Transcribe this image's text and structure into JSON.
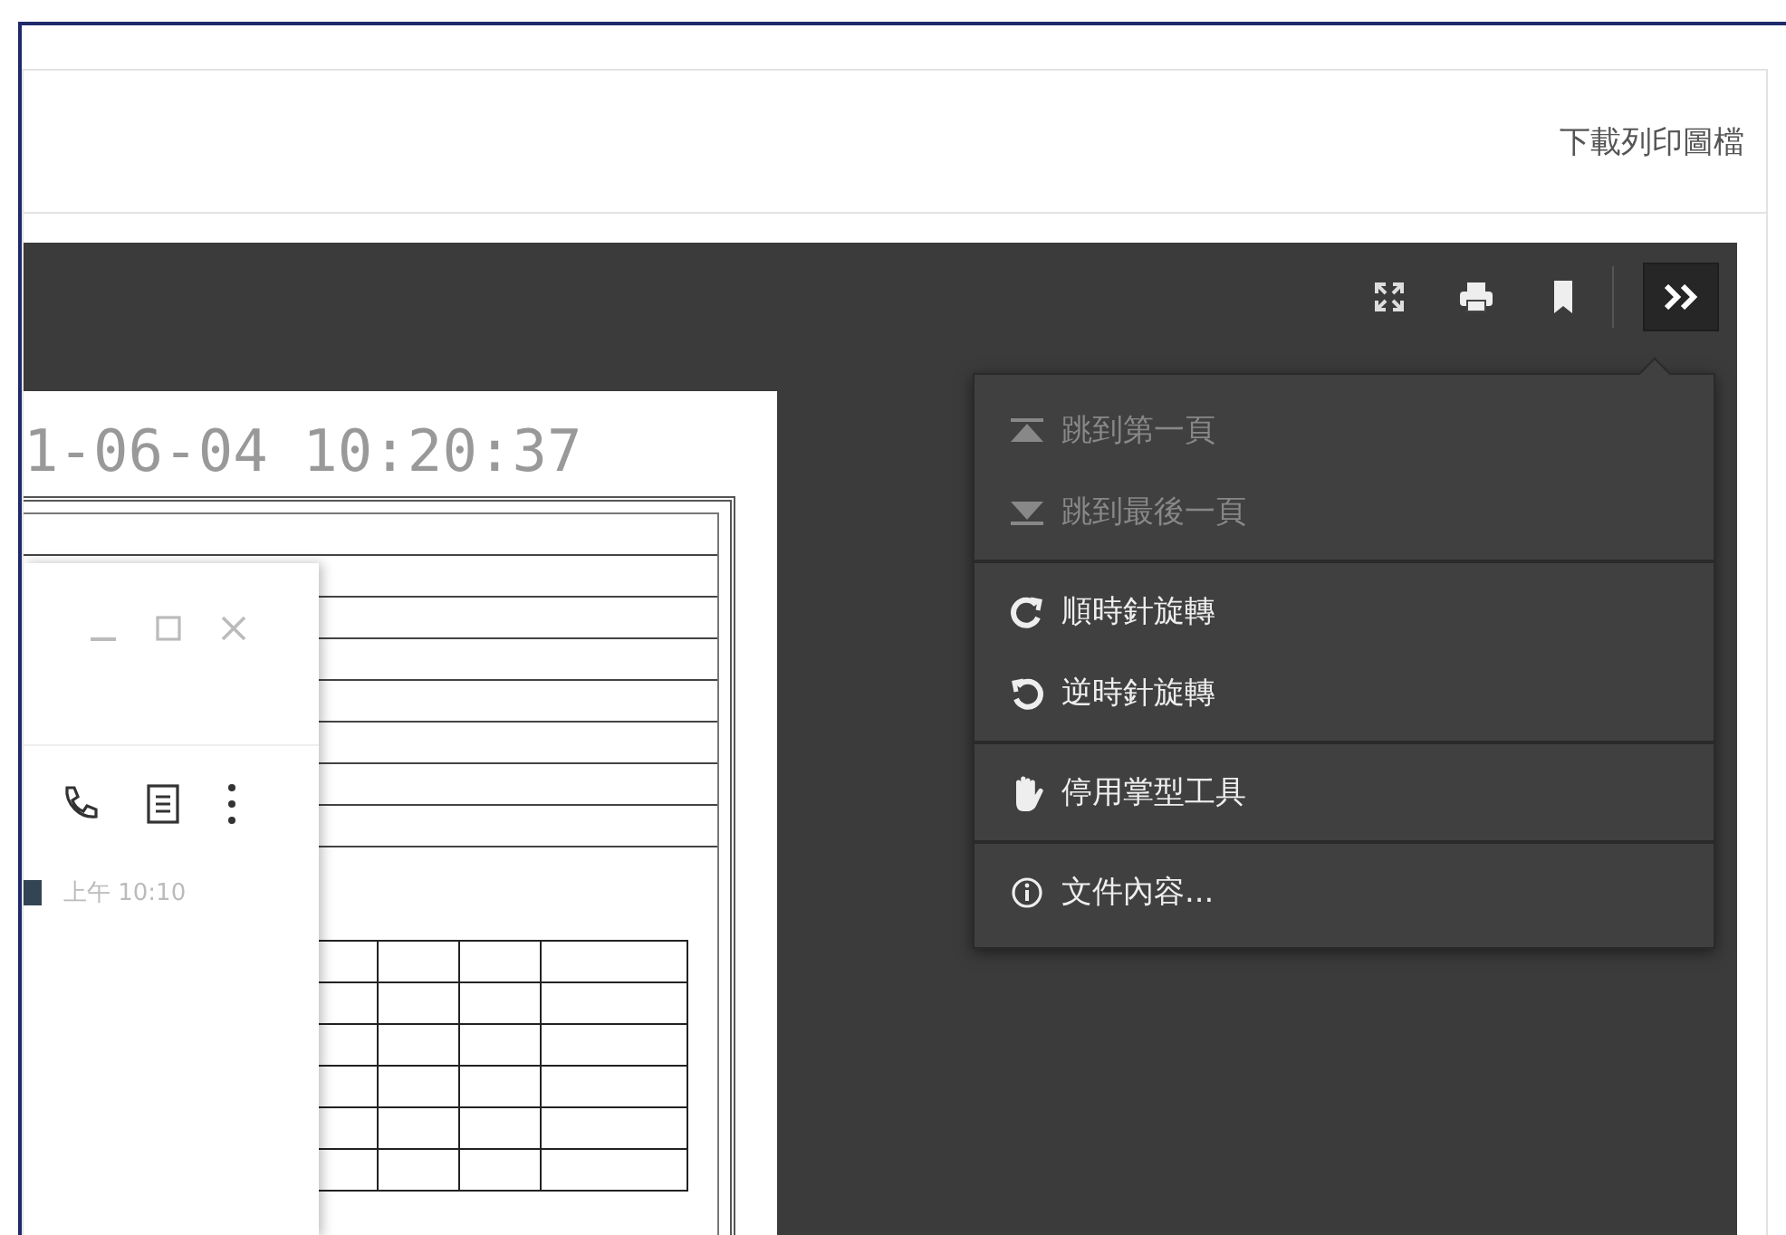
{
  "header": {
    "link": "下載列印圖檔"
  },
  "toolbar": {
    "buttons": [
      {
        "kind": "fullscreen",
        "expanded": false
      },
      {
        "kind": "print",
        "expanded": false
      },
      {
        "kind": "bookmark",
        "expanded": false
      },
      {
        "kind": "more",
        "expanded": true
      }
    ]
  },
  "menu": {
    "groups": [
      [
        {
          "kind": "first",
          "label": "跳到第一頁",
          "disabled": true
        },
        {
          "kind": "last",
          "label": "跳到最後一頁",
          "disabled": true
        }
      ],
      [
        {
          "kind": "rotate-cw",
          "label": "順時針旋轉",
          "disabled": false
        },
        {
          "kind": "rotate-ccw",
          "label": "逆時針旋轉",
          "disabled": false
        }
      ],
      [
        {
          "kind": "hand",
          "label": "停用掌型工具",
          "disabled": false
        }
      ],
      [
        {
          "kind": "info",
          "label": "文件內容...",
          "disabled": false
        }
      ]
    ]
  },
  "page": {
    "timestamp": "1-06-04  10:20:37"
  },
  "overlay_window": {
    "time": "上午 10:10"
  }
}
